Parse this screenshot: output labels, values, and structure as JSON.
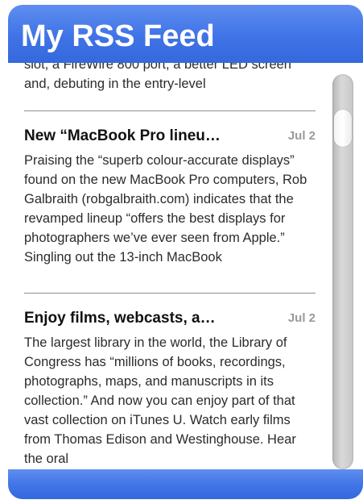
{
  "window": {
    "title": "My RSS Feed"
  },
  "feed": {
    "partial_item": {
      "body_top": "slot, a FireWire 800 port, a better LED screen and, debuting in the entry-level"
    },
    "items": [
      {
        "title": "New “MacBook Pro lineu…",
        "date": "Jul 2",
        "body": "Praising the “superb colour-accurate displays” found on the new MacBook Pro computers, Rob Galbraith (robgalbraith.com) indicates that the revamped lineup “offers the best displays for photographers we’ve ever seen from Apple.” Singling out the 13-inch MacBook"
      },
      {
        "title": "Enjoy films, webcasts, a…",
        "date": "Jul 2",
        "body": "The largest library in the world, the Library of Congress has “millions of books, recordings, photographs, maps, and manuscripts in its collection.” And now you can enjoy part of that vast collection on iTunes U. Watch early films from Thomas Edison and Westinghouse. Hear the oral"
      }
    ]
  },
  "colors": {
    "header_blue": "#3f73e6",
    "date_gray": "#9a9a9a"
  }
}
